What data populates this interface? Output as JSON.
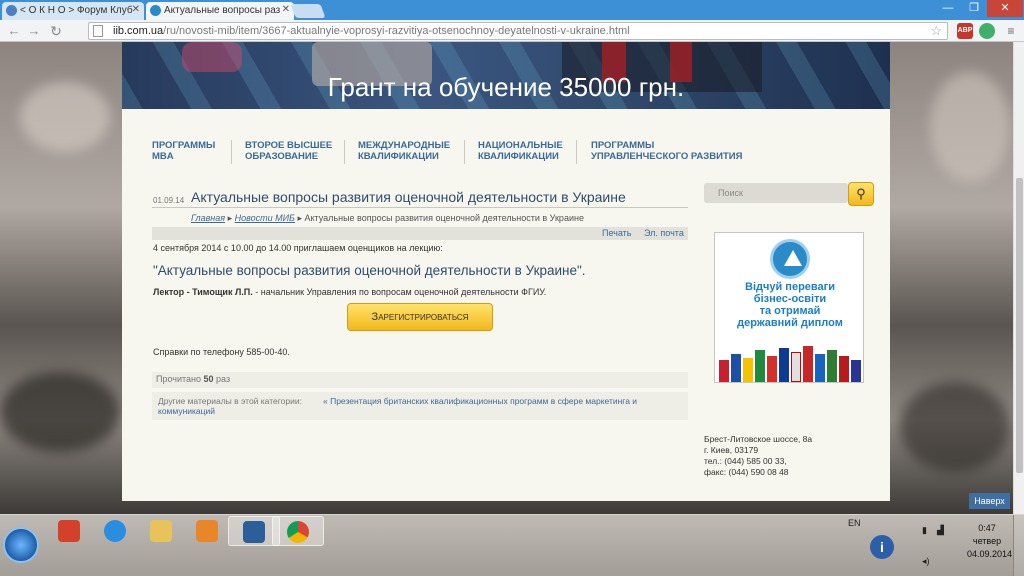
{
  "browser": {
    "tabs": [
      {
        "label": "< О К Н О > Форум Клуб"
      },
      {
        "label": "Актуальные вопросы раз"
      }
    ],
    "url_host": "iib.com.ua",
    "url_path": "/ru/novosti-mib/item/3667-aktualnyie-voprosyi-razvitiya-otsenochnoy-deyatelnosti-v-ukraine.html",
    "abp_badge": "ABP"
  },
  "site": {
    "banner_title": "Грант на обучение 35000 грн.",
    "menu": [
      {
        "line1": "ПРОГРАММЫ",
        "line2": "MBA"
      },
      {
        "line1": "ВТОРОЕ ВЫСШЕЕ",
        "line2": "ОБРАЗОВАНИЕ"
      },
      {
        "line1": "МЕЖДУНАРОДНЫЕ",
        "line2": "КВАЛИФИКАЦИИ"
      },
      {
        "line1": "НАЦИОНАЛЬНЫЕ",
        "line2": "КВАЛИФИКАЦИИ"
      },
      {
        "line1": "ПРОГРАММЫ",
        "line2": "УПРАВЛЕНЧЕСКОГО РАЗВИТИЯ"
      }
    ],
    "article": {
      "date": "01.09.14",
      "title": "Актуальные вопросы развития оценочной деятельности в Украине",
      "breadcrumb": {
        "home": "Главная",
        "section": "Новости МИБ",
        "separator": "▸",
        "current": "Актуальные вопросы развития оценочной деятельности в Украине"
      },
      "print_label": "Печать",
      "email_label": "Эл. почта",
      "intro": "4 сентября 2014 с 10.00 до 14.00 приглашаем оценщиков на лекцию:",
      "quote": "\"Актуальные вопросы развития оценочной деятельности в Украине\".",
      "lector_name": "Лектор - Тимощик Л.П.",
      "lector_desc": " - начальник Управления по вопросам оценочной деятельности ФГИУ.",
      "register_button": "Зарегистрироваться",
      "phone": "Справки по телефону 585-00-40.",
      "reads_prefix": "Прочитано",
      "reads_count": "50",
      "reads_suffix": "раз",
      "other_label": "Другие материалы в этой категории:",
      "other_link": "« Презентация британских квалификационных программ в сфере маркетинга и коммуникаций"
    },
    "search_placeholder": "Поиск",
    "ad_text": [
      "Відчуй переваги",
      "бізнес-освіти",
      "та отримай",
      "державний диплом"
    ],
    "address": [
      "Брест-Литовское шоссе, 8а",
      "г. Киев, 03179",
      "тел.: (044) 585 00 33,",
      "факс: (044) 590 08 48"
    ],
    "top_button": "Наверх"
  },
  "taskbar": {
    "lang": "EN",
    "time": "0:47",
    "day": "четвер",
    "date": "04.09.2014"
  },
  "colors": {
    "link": "#3a6a9a",
    "title": "#2e4d6e",
    "button_yellow": "#f2b81c",
    "chrome_blue": "#3d8fd6"
  }
}
